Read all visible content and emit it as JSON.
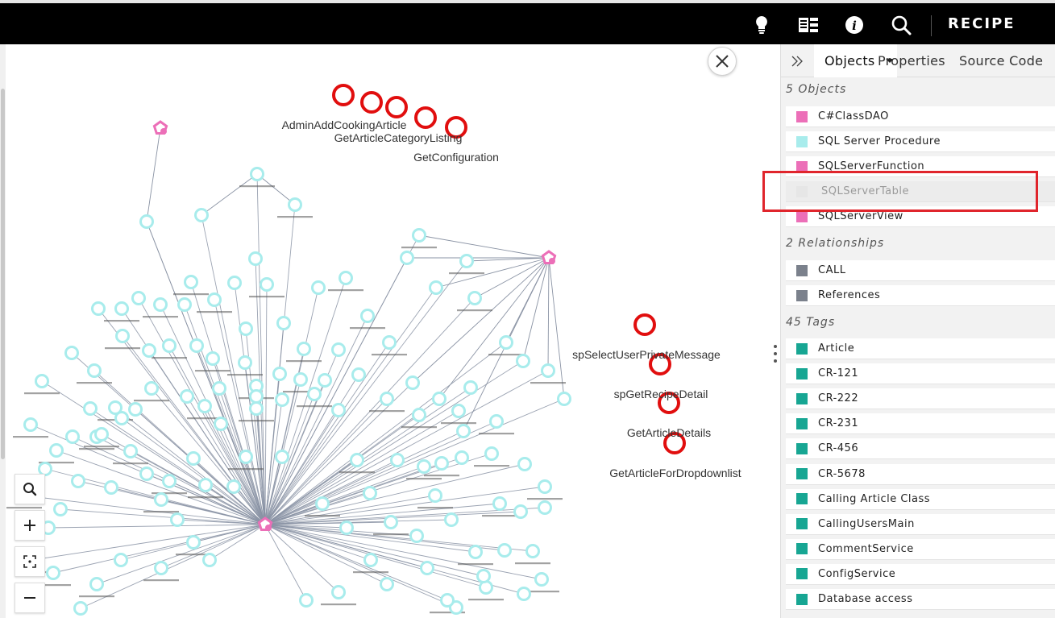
{
  "header": {
    "title": "RECIPE",
    "icons": [
      "lightbulb-icon",
      "database-view-icon",
      "info-icon",
      "search-icon"
    ]
  },
  "graph": {
    "highlighted_labels": [
      "AdminAddCookingArticle",
      "GetArticleCategoryListing",
      "GetConfiguration",
      "spSelectUserPrivateMessage",
      "spGetRecipeDetail",
      "GetArticleDetails",
      "GetArticleForDropdownlist"
    ],
    "colors": {
      "hub": "#ec6fb8",
      "procedure_node": "#a8ecec",
      "highlight_node": "#e10e0e",
      "edge": "#8a93a4"
    }
  },
  "panel": {
    "tabs": {
      "objects": "Objects",
      "properties": "Properties",
      "source_code": "Source Code"
    },
    "objects_header": "5 Objects",
    "objects": [
      {
        "label": "C#ClassDAO",
        "color": "#ec6fb8"
      },
      {
        "label": "SQL Server Procedure",
        "color": "#a8ecec"
      },
      {
        "label": "SQLServerFunction",
        "color": "#ec6fb8"
      },
      {
        "label": "SQLServerTable",
        "color": "#e6e6e6"
      },
      {
        "label": "SQLServerView",
        "color": "#ec6fb8"
      }
    ],
    "relationships_header": "2 Relationships",
    "relationships": [
      {
        "label": "CALL",
        "color": "#7b818c"
      },
      {
        "label": "References",
        "color": "#7b818c"
      }
    ],
    "tags_header": "45 Tags",
    "tags": [
      {
        "label": "Article",
        "color": "#17a693"
      },
      {
        "label": "CR-121",
        "color": "#17a693"
      },
      {
        "label": "CR-222",
        "color": "#17a693"
      },
      {
        "label": "CR-231",
        "color": "#17a693"
      },
      {
        "label": "CR-456",
        "color": "#17a693"
      },
      {
        "label": "CR-5678",
        "color": "#17a693"
      },
      {
        "label": "Calling Article Class",
        "color": "#17a693"
      },
      {
        "label": "CallingUsersMain",
        "color": "#17a693"
      },
      {
        "label": "CommentService",
        "color": "#17a693"
      },
      {
        "label": "ConfigService",
        "color": "#17a693"
      },
      {
        "label": "Database access",
        "color": "#17a693"
      }
    ]
  }
}
